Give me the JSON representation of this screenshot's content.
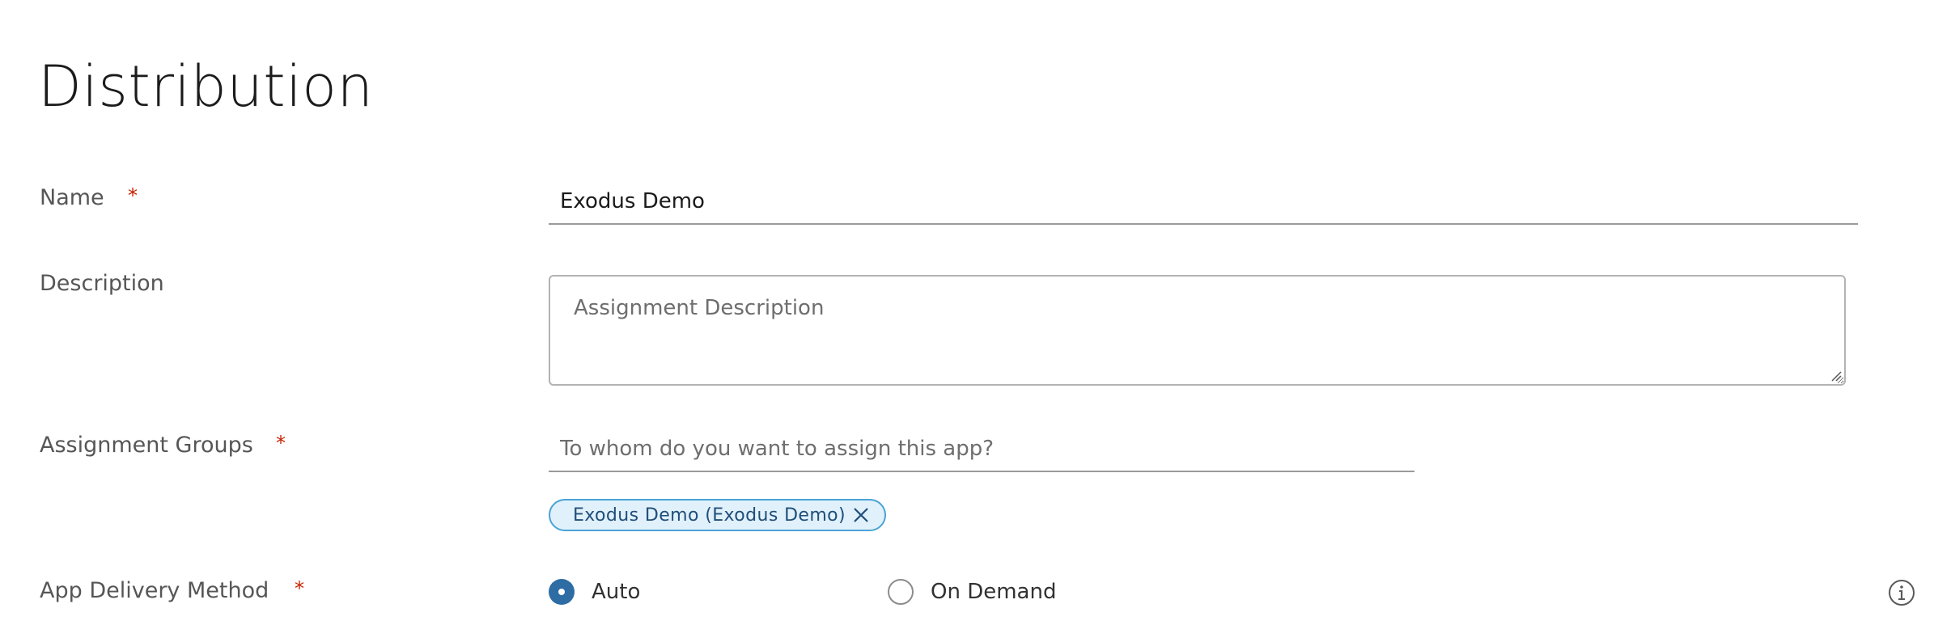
{
  "page": {
    "title": "Distribution"
  },
  "form": {
    "name": {
      "label": "Name",
      "required_mark": "*",
      "value": "Exodus Demo"
    },
    "description": {
      "label": "Description",
      "placeholder": "Assignment Description",
      "value": ""
    },
    "assignment_groups": {
      "label": "Assignment Groups",
      "required_mark": "*",
      "placeholder": "To whom do you want to assign this app?",
      "selected": [
        {
          "label": "Exodus Demo (Exodus Demo)",
          "remove_icon": "close-icon"
        }
      ]
    },
    "app_delivery_method": {
      "label": "App Delivery Method",
      "required_mark": "*",
      "options": [
        {
          "label": "Auto",
          "checked": true
        },
        {
          "label": "On Demand",
          "checked": false
        }
      ],
      "info_icon": "info-icon"
    }
  },
  "colors": {
    "required": "#c92100",
    "radio_checked": "#2e6ca4",
    "chip_border": "#4aa3d6",
    "chip_background": "#e1f1fb"
  }
}
